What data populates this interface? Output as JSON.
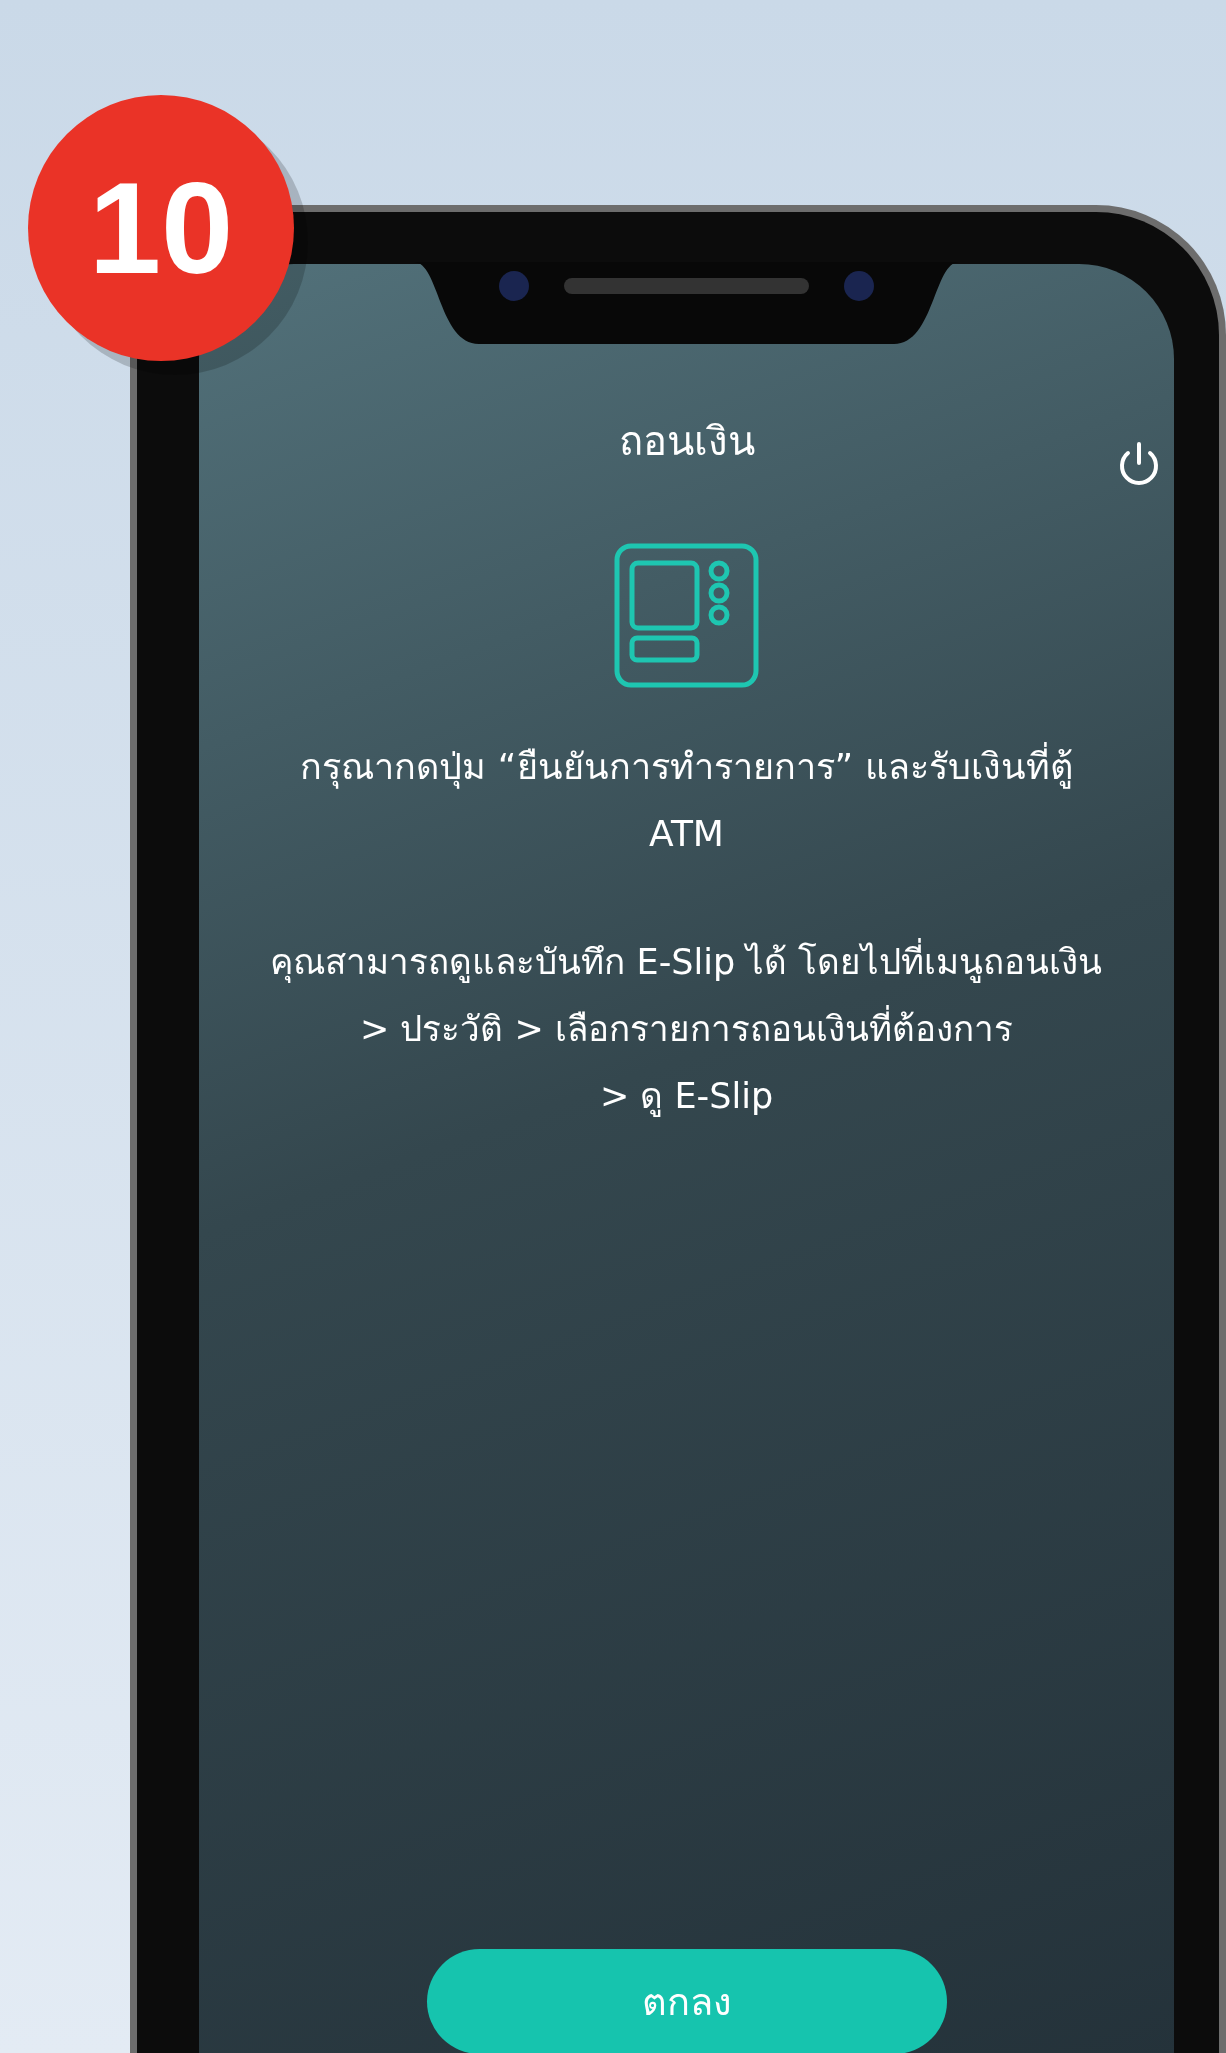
{
  "step_badge": "10",
  "screen": {
    "title": "ถอนเงิน",
    "instruction": "กรุณากดปุ่ม “ยืนยันการทำรายการ” และรับเงินที่ตู้ ATM",
    "note_lines": [
      "คุณสามารถดูและบันทึก E-Slip ได้ โดยไปที่เมนูถอนเงิน",
      "> ประวัติ > เลือกรายการถอนเงินที่ต้องการ",
      "> ดู E-Slip"
    ],
    "button": "ตกลง"
  }
}
